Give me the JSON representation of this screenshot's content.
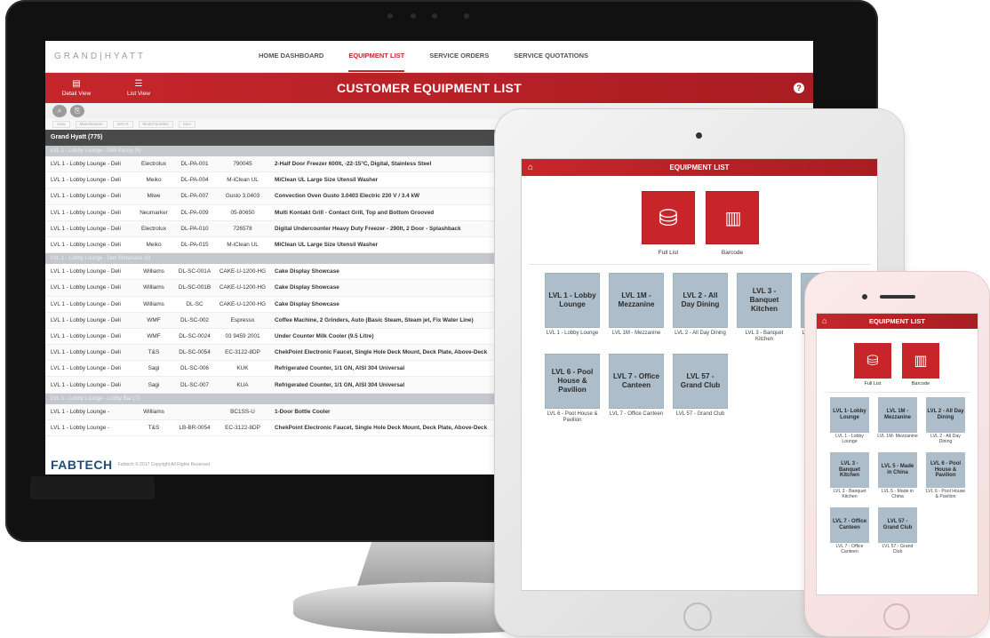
{
  "desktop": {
    "logo": "GRAND|HYATT",
    "nav": [
      "HOME DASHBOARD",
      "EQUIPMENT LIST",
      "SERVICE ORDERS",
      "SERVICE QUOTATIONS"
    ],
    "nav_active_index": 1,
    "views": [
      "Detail View",
      "List View"
    ],
    "title": "CUSTOMER EQUIPMENT LIST",
    "help": "?",
    "filters": [
      "Area",
      "Manufacturer",
      "Item #",
      "Model Number",
      "Item"
    ],
    "group": "Grand Hyatt (775)",
    "sections": [
      {
        "header": "LVL 1 - Lobby Lounge - Deli Pastry (6)",
        "rows": [
          [
            "LVL 1 - Lobby Lounge - Deli",
            "Electrolux",
            "DL-PA-001",
            "790045",
            "2-Half Door Freezer 600lt, -22-15°C, Digital, Stainless Steel"
          ],
          [
            "LVL 1 - Lobby Lounge - Deli",
            "Meiko",
            "DL-PA-004",
            "M-iClean UL",
            "MiClean UL Large Size Utensil Washer"
          ],
          [
            "LVL 1 - Lobby Lounge - Deli",
            "Miwe",
            "DL-PA-007",
            "Gusto 3.0403",
            "Convection Oven Gusto 3.0403 Electric 230 V / 3.4 kW"
          ],
          [
            "LVL 1 - Lobby Lounge - Deli",
            "Neumarker",
            "DL-PA-009",
            "05-80650",
            "Multi Kontakt Grill - Contact Grill, Top and Bottom Grooved"
          ],
          [
            "LVL 1 - Lobby Lounge - Deli",
            "Electrolux",
            "DL-PA-010",
            "726578",
            "Digital Undercounter Heavy Duty Freezer - 290lt, 2 Door - Splashback"
          ],
          [
            "LVL 1 - Lobby Lounge - Deli",
            "Meiko",
            "DL-PA-015",
            "M-iClean UL",
            "MiClean UL Large Size Utensil Washer"
          ]
        ]
      },
      {
        "header": "LVL 1 - Lobby Lounge - Deli Showcase (8)",
        "rows": [
          [
            "LVL 1 - Lobby Lounge - Deli",
            "Williams",
            "DL-SC-001A",
            "CAKE-U-1200-HG",
            "Cake Display Showcase"
          ],
          [
            "LVL 1 - Lobby Lounge - Deli",
            "Williams",
            "DL-SC-001B",
            "CAKE-U-1200-HG",
            "Cake Display Showcase"
          ],
          [
            "LVL 1 - Lobby Lounge - Deli",
            "Williams",
            "DL-SC",
            "CAKE-U-1200-HG",
            "Cake Display Showcase"
          ],
          [
            "LVL 1 - Lobby Lounge - Deli",
            "WMF",
            "DL-SC-002",
            "Espresso",
            "Coffee Machine, 2 Grinders, Auto (Basic Steam, Steam jet, Fix Water Line)"
          ],
          [
            "LVL 1 - Lobby Lounge - Deli",
            "WMF",
            "DL-SC-0024",
            "03 9459 2001",
            "Under Counter Milk Cooler (9.5 Litre)"
          ],
          [
            "LVL 1 - Lobby Lounge - Deli",
            "T&S",
            "DL-SC-0054",
            "EC-3122-8DP",
            "ChekPoint Electronic Faucet, Single Hole Deck Mount, Deck Plate, Above-Deck"
          ],
          [
            "LVL 1 - Lobby Lounge - Deli",
            "Sagi",
            "DL-SC-006",
            "KUK",
            "Refrigerated Counter, 1/1 GN, AISI 304 Universal"
          ],
          [
            "LVL 1 - Lobby Lounge - Deli",
            "Sagi",
            "DL-SC-007",
            "KUA",
            "Refrigerated Counter, 1/1 GN, AISI 304 Universal"
          ]
        ]
      },
      {
        "header": "LVL 1 - Lobby Lounge - Lobby Bar (7)",
        "rows": [
          [
            "LVL 1 - Lobby Lounge -",
            "Williams",
            "",
            "BC1SS-U",
            "1-Door Bottle Cooler"
          ],
          [
            "LVL 1 - Lobby Lounge -",
            "T&S",
            "LB-BR-0054",
            "EC-3122-8DP",
            "ChekPoint Electronic Faucet, Single Hole Deck Mount, Deck Plate, Above-Deck"
          ]
        ]
      }
    ],
    "footer_brand": "FABTECH",
    "footer_copy": "Fabtech © 2017 Copyright All Rights Reserved"
  },
  "tablet": {
    "title": "EQUIPMENT LIST",
    "buttons": [
      {
        "label": "Full List",
        "icon": "database-icon"
      },
      {
        "label": "Barcode",
        "icon": "barcode-icon"
      }
    ],
    "locations": [
      {
        "tile": "LVL 1 - Lobby Lounge",
        "caption": "LVL 1 - Lobby Lounge"
      },
      {
        "tile": "LVL 1M - Mezzanine",
        "caption": "LVL 1M - Mezzanine"
      },
      {
        "tile": "LVL 2 - All Day Dining",
        "caption": "LVL 2 - All Day Dining"
      },
      {
        "tile": "LVL 3 - Banquet Kitchen",
        "caption": "LVL 3 - Banquet Kitchen"
      },
      {
        "tile": "LVL 5 - Made in China",
        "caption": "LVL 5 - Made in China"
      },
      {
        "tile": "LVL 6 - Pool House & Pavilion",
        "caption": "LVL 6 - Pool House & Pavilion"
      },
      {
        "tile": "LVL 7 - Office Canteen",
        "caption": "LVL 7 - Office Canteen"
      },
      {
        "tile": "LVL 57 - Grand Club",
        "caption": "LVL 57 - Grand Club"
      }
    ]
  },
  "phone": {
    "title": "EQUIPMENT LIST",
    "buttons": [
      {
        "label": "Full List",
        "icon": "database-icon"
      },
      {
        "label": "Barcode",
        "icon": "barcode-icon"
      }
    ],
    "locations": [
      {
        "tile": "LVL 1- Lobby Lounge",
        "caption": "LVL 1 - Lobby Lounge"
      },
      {
        "tile": "LVL 1M - Mezzanine",
        "caption": "LVL 1M- Mezzanine"
      },
      {
        "tile": "LVL 2 - All Day Dining",
        "caption": "LVL 2 - All Day Dining"
      },
      {
        "tile": "LVL 3 - Banquet Kitchen",
        "caption": "LVL 3 - Banquet Kitchen"
      },
      {
        "tile": "LVL 5 - Made in China",
        "caption": "LVL 5 - Made in China"
      },
      {
        "tile": "LVL 6 - Pool House & Pavilion",
        "caption": "LVL 6 - Pool House & Pavilion"
      },
      {
        "tile": "LVL 7 - Office Canteen",
        "caption": "LVL 7 - Office Canteen"
      },
      {
        "tile": "LVL 57 - Grand Club",
        "caption": "LVL 57 - Grand Club"
      }
    ]
  },
  "colors": {
    "brand_red": "#c6262b",
    "tile_blue_grey": "#aebdca",
    "nav_active": "#c1272d",
    "footer_brand": "#1f4e79"
  }
}
